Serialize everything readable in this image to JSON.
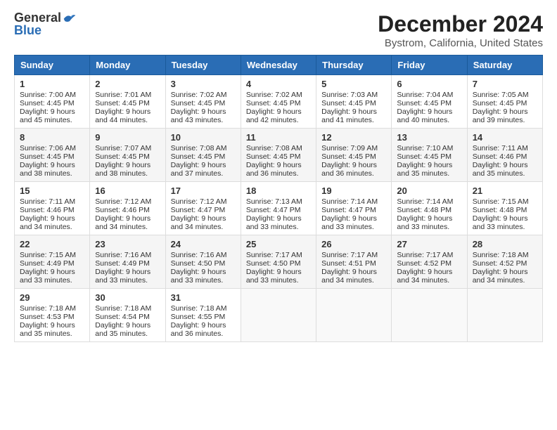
{
  "header": {
    "logo_general": "General",
    "logo_blue": "Blue",
    "title": "December 2024",
    "subtitle": "Bystrom, California, United States"
  },
  "days_of_week": [
    "Sunday",
    "Monday",
    "Tuesday",
    "Wednesday",
    "Thursday",
    "Friday",
    "Saturday"
  ],
  "weeks": [
    [
      {
        "day": 1,
        "sunrise": "7:00 AM",
        "sunset": "4:45 PM",
        "daylight": "9 hours and 45 minutes."
      },
      {
        "day": 2,
        "sunrise": "7:01 AM",
        "sunset": "4:45 PM",
        "daylight": "9 hours and 44 minutes."
      },
      {
        "day": 3,
        "sunrise": "7:02 AM",
        "sunset": "4:45 PM",
        "daylight": "9 hours and 43 minutes."
      },
      {
        "day": 4,
        "sunrise": "7:02 AM",
        "sunset": "4:45 PM",
        "daylight": "9 hours and 42 minutes."
      },
      {
        "day": 5,
        "sunrise": "7:03 AM",
        "sunset": "4:45 PM",
        "daylight": "9 hours and 41 minutes."
      },
      {
        "day": 6,
        "sunrise": "7:04 AM",
        "sunset": "4:45 PM",
        "daylight": "9 hours and 40 minutes."
      },
      {
        "day": 7,
        "sunrise": "7:05 AM",
        "sunset": "4:45 PM",
        "daylight": "9 hours and 39 minutes."
      }
    ],
    [
      {
        "day": 8,
        "sunrise": "7:06 AM",
        "sunset": "4:45 PM",
        "daylight": "9 hours and 38 minutes."
      },
      {
        "day": 9,
        "sunrise": "7:07 AM",
        "sunset": "4:45 PM",
        "daylight": "9 hours and 38 minutes."
      },
      {
        "day": 10,
        "sunrise": "7:08 AM",
        "sunset": "4:45 PM",
        "daylight": "9 hours and 37 minutes."
      },
      {
        "day": 11,
        "sunrise": "7:08 AM",
        "sunset": "4:45 PM",
        "daylight": "9 hours and 36 minutes."
      },
      {
        "day": 12,
        "sunrise": "7:09 AM",
        "sunset": "4:45 PM",
        "daylight": "9 hours and 36 minutes."
      },
      {
        "day": 13,
        "sunrise": "7:10 AM",
        "sunset": "4:45 PM",
        "daylight": "9 hours and 35 minutes."
      },
      {
        "day": 14,
        "sunrise": "7:11 AM",
        "sunset": "4:46 PM",
        "daylight": "9 hours and 35 minutes."
      }
    ],
    [
      {
        "day": 15,
        "sunrise": "7:11 AM",
        "sunset": "4:46 PM",
        "daylight": "9 hours and 34 minutes."
      },
      {
        "day": 16,
        "sunrise": "7:12 AM",
        "sunset": "4:46 PM",
        "daylight": "9 hours and 34 minutes."
      },
      {
        "day": 17,
        "sunrise": "7:12 AM",
        "sunset": "4:47 PM",
        "daylight": "9 hours and 34 minutes."
      },
      {
        "day": 18,
        "sunrise": "7:13 AM",
        "sunset": "4:47 PM",
        "daylight": "9 hours and 33 minutes."
      },
      {
        "day": 19,
        "sunrise": "7:14 AM",
        "sunset": "4:47 PM",
        "daylight": "9 hours and 33 minutes."
      },
      {
        "day": 20,
        "sunrise": "7:14 AM",
        "sunset": "4:48 PM",
        "daylight": "9 hours and 33 minutes."
      },
      {
        "day": 21,
        "sunrise": "7:15 AM",
        "sunset": "4:48 PM",
        "daylight": "9 hours and 33 minutes."
      }
    ],
    [
      {
        "day": 22,
        "sunrise": "7:15 AM",
        "sunset": "4:49 PM",
        "daylight": "9 hours and 33 minutes."
      },
      {
        "day": 23,
        "sunrise": "7:16 AM",
        "sunset": "4:49 PM",
        "daylight": "9 hours and 33 minutes."
      },
      {
        "day": 24,
        "sunrise": "7:16 AM",
        "sunset": "4:50 PM",
        "daylight": "9 hours and 33 minutes."
      },
      {
        "day": 25,
        "sunrise": "7:17 AM",
        "sunset": "4:50 PM",
        "daylight": "9 hours and 33 minutes."
      },
      {
        "day": 26,
        "sunrise": "7:17 AM",
        "sunset": "4:51 PM",
        "daylight": "9 hours and 34 minutes."
      },
      {
        "day": 27,
        "sunrise": "7:17 AM",
        "sunset": "4:52 PM",
        "daylight": "9 hours and 34 minutes."
      },
      {
        "day": 28,
        "sunrise": "7:18 AM",
        "sunset": "4:52 PM",
        "daylight": "9 hours and 34 minutes."
      }
    ],
    [
      {
        "day": 29,
        "sunrise": "7:18 AM",
        "sunset": "4:53 PM",
        "daylight": "9 hours and 35 minutes."
      },
      {
        "day": 30,
        "sunrise": "7:18 AM",
        "sunset": "4:54 PM",
        "daylight": "9 hours and 35 minutes."
      },
      {
        "day": 31,
        "sunrise": "7:18 AM",
        "sunset": "4:55 PM",
        "daylight": "9 hours and 36 minutes."
      },
      null,
      null,
      null,
      null
    ]
  ],
  "labels": {
    "sunrise": "Sunrise:",
    "sunset": "Sunset:",
    "daylight": "Daylight:"
  }
}
